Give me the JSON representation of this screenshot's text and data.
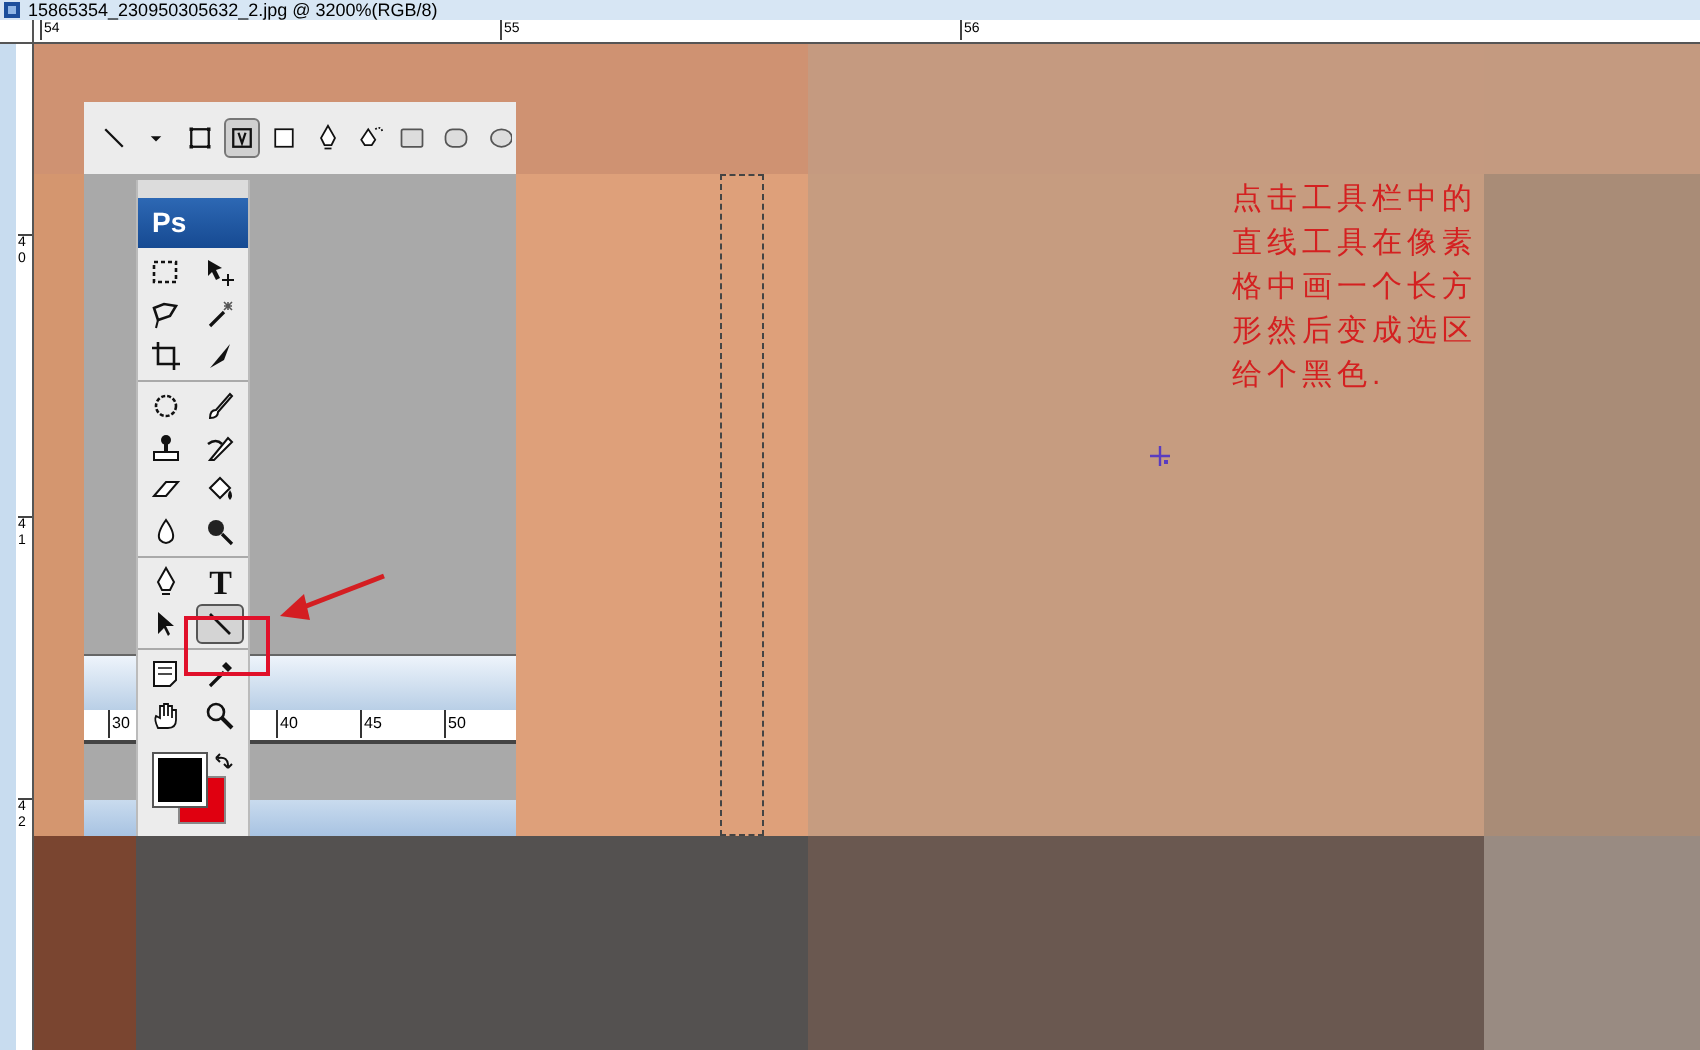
{
  "window": {
    "title": "15865354_230950305632_2.jpg @ 3200%(RGB/8)"
  },
  "top_ruler": [
    "54",
    "55",
    "56"
  ],
  "left_ruler": [
    "40",
    "41",
    "42"
  ],
  "canvas": {
    "rows": [
      {
        "cells": [
          {
            "color": "#cf9272"
          },
          {
            "color": "#c59a80"
          },
          {
            "color": "#c49a80"
          }
        ]
      },
      {
        "cells": [
          {
            "color": "#d4966f"
          },
          {
            "color": "#dea07a"
          },
          {
            "color": "#c69c80"
          },
          {
            "color": "#a98c77"
          }
        ]
      },
      {
        "cells": [
          {
            "color": "#7a4530"
          },
          {
            "color": "#545150"
          },
          {
            "color": "#6a5850"
          },
          {
            "color": "#998b82"
          }
        ]
      }
    ]
  },
  "inset": {
    "options_bar": [
      {
        "kind": "line",
        "selected": false
      },
      {
        "kind": "caret",
        "selected": false
      },
      {
        "kind": "shape-layers",
        "selected": false
      },
      {
        "kind": "paths",
        "selected": true
      },
      {
        "kind": "fill-pixels",
        "selected": false
      },
      {
        "kind": "pen",
        "selected": false
      },
      {
        "kind": "freeform-pen",
        "selected": false
      },
      {
        "kind": "rectangle",
        "selected": false
      },
      {
        "kind": "rounded-rectangle",
        "selected": false
      },
      {
        "kind": "ellipse",
        "selected": false
      }
    ],
    "toolbox": {
      "logo": "Ps",
      "groups": [
        [
          [
            {
              "kind": "marquee",
              "selected": false
            },
            {
              "kind": "move",
              "selected": false
            }
          ],
          [
            {
              "kind": "lasso",
              "selected": false
            },
            {
              "kind": "wand",
              "selected": false
            }
          ],
          [
            {
              "kind": "crop",
              "selected": false
            },
            {
              "kind": "slice",
              "selected": false
            }
          ]
        ],
        [
          [
            {
              "kind": "healing",
              "selected": false
            },
            {
              "kind": "brush",
              "selected": false
            }
          ],
          [
            {
              "kind": "stamp",
              "selected": false
            },
            {
              "kind": "history-brush",
              "selected": false
            }
          ],
          [
            {
              "kind": "eraser",
              "selected": false
            },
            {
              "kind": "bucket",
              "selected": false
            }
          ],
          [
            {
              "kind": "drop",
              "selected": false
            },
            {
              "kind": "dodge",
              "selected": false
            }
          ]
        ],
        [
          [
            {
              "kind": "pen",
              "selected": false
            },
            {
              "kind": "type",
              "glyph": "T",
              "selected": false
            }
          ],
          [
            {
              "kind": "arrow",
              "selected": false
            },
            {
              "kind": "line",
              "selected": true
            }
          ]
        ],
        [
          [
            {
              "kind": "notes",
              "selected": false
            },
            {
              "kind": "eyedropper",
              "selected": false
            }
          ],
          [
            {
              "kind": "hand",
              "selected": false
            },
            {
              "kind": "zoom",
              "selected": false
            }
          ]
        ]
      ]
    },
    "ruler": [
      "30",
      "40",
      "45",
      "50"
    ]
  },
  "annotation": {
    "text": "点击工具栏中的直线工具在像素格中画一个长方形然后变成选区给个黑色."
  }
}
